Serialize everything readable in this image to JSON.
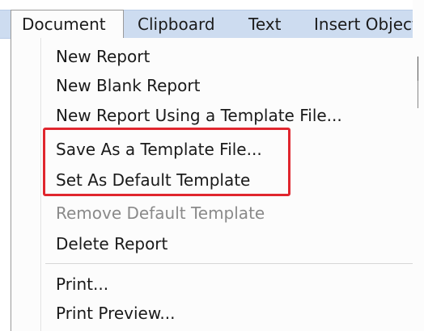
{
  "menubar": {
    "items": [
      {
        "label": "Document"
      },
      {
        "label": "Clipboard"
      },
      {
        "label": "Text"
      },
      {
        "label": "Insert Object"
      }
    ]
  },
  "document_menu": {
    "items": [
      {
        "label": "New Report",
        "enabled": true
      },
      {
        "label": "New Blank Report",
        "enabled": true
      },
      {
        "label": "New Report Using a Template File...",
        "enabled": true
      },
      {
        "label": "Save As a Template File...",
        "enabled": true,
        "highlighted": true
      },
      {
        "label": "Set As Default Template",
        "enabled": true,
        "highlighted": true
      },
      {
        "label": "Remove Default Template",
        "enabled": false
      },
      {
        "label": "Delete Report",
        "enabled": true
      },
      {
        "label": "Print...",
        "enabled": true
      },
      {
        "label": "Print Preview...",
        "enabled": true
      }
    ]
  },
  "annotation": {
    "highlight_color": "#e0262e"
  },
  "colors": {
    "menubar_bg": "#cddcf0",
    "menu_bg": "#fcfcfc",
    "disabled_text": "#8a8a8a"
  }
}
